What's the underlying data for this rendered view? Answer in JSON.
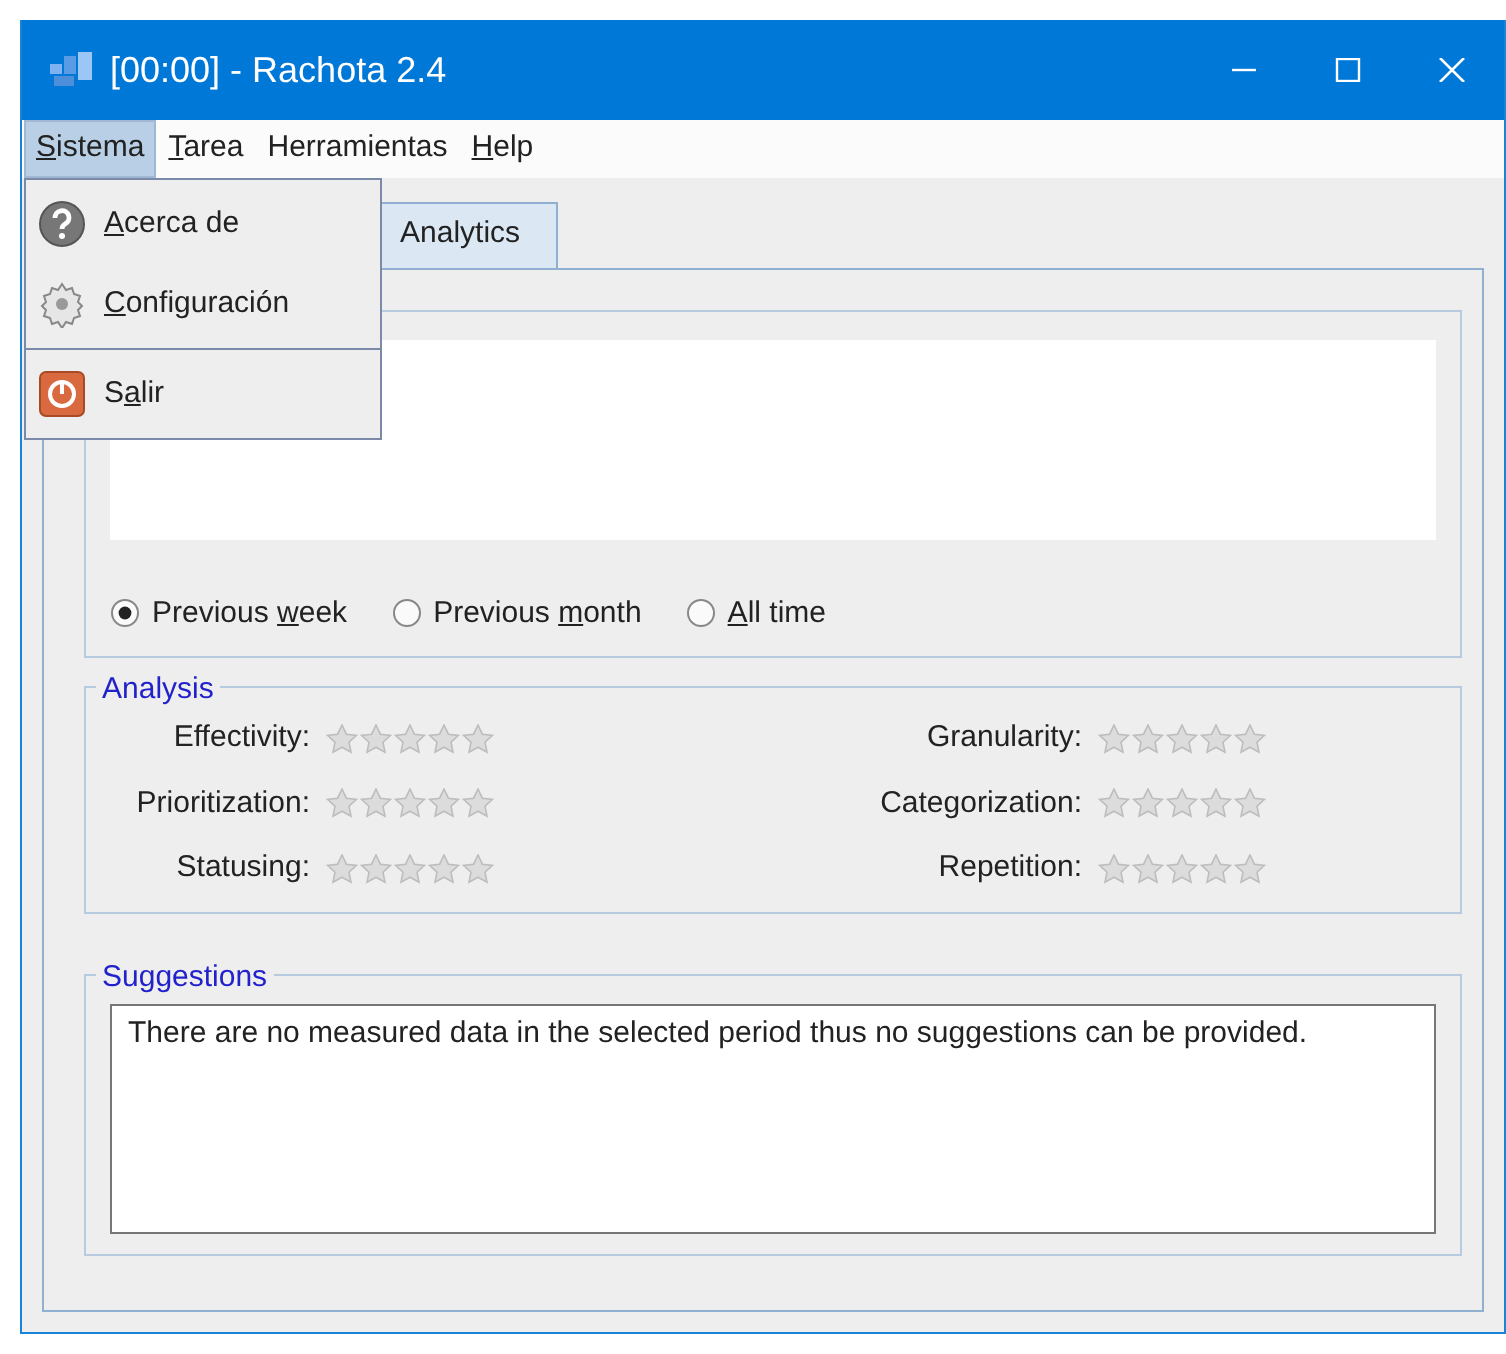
{
  "window": {
    "title": "[00:00] - Rachota 2.4"
  },
  "menu_bar": [
    {
      "key": "S",
      "post": "istema",
      "selected": true
    },
    {
      "key": "T",
      "post": "area",
      "selected": false
    },
    {
      "pre": "Herramientas",
      "selected": false
    },
    {
      "key": "H",
      "post": "elp",
      "selected": false
    }
  ],
  "open_menu": {
    "items": [
      {
        "kind": "item",
        "key": "A",
        "post": "cerca de"
      },
      {
        "kind": "item",
        "key": "C",
        "post": "onfiguración"
      },
      {
        "kind": "separator"
      },
      {
        "kind": "item",
        "pre": "S",
        "key": "a",
        "post": "lir"
      }
    ]
  },
  "tabs": [
    {
      "label": "Analytics",
      "selected": true
    }
  ],
  "period": {
    "options": [
      {
        "pre": "Previous ",
        "key": "w",
        "post": "eek",
        "checked": true
      },
      {
        "pre": "Previous ",
        "key": "m",
        "post": "onth",
        "checked": false
      },
      {
        "key": "A",
        "post": "ll time",
        "checked": false
      }
    ]
  },
  "analysis": {
    "title": "Analysis",
    "metrics": [
      {
        "label": "Effectivity:",
        "stars": 0
      },
      {
        "label": "Granularity:",
        "stars": 0
      },
      {
        "label": "Prioritization:",
        "stars": 0
      },
      {
        "label": "Categorization:",
        "stars": 0
      },
      {
        "label": "Statusing:",
        "stars": 0
      },
      {
        "label": "Repetition:",
        "stars": 0
      }
    ]
  },
  "suggestions": {
    "title": "Suggestions",
    "text": "There are no measured data in the selected period thus no suggestions can be provided."
  }
}
